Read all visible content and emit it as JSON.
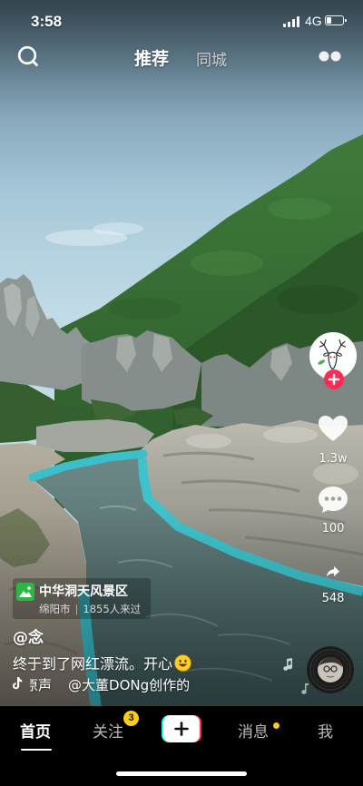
{
  "status_bar": {
    "time": "3:58",
    "network": "4G",
    "signal_icon": "signal-bars-icon",
    "battery_icon": "battery-icon",
    "battery_level": 0.3
  },
  "top_bar": {
    "left_icon": "search-icon",
    "right_icon": "more-dots-icon",
    "tabs": [
      {
        "label": "推荐",
        "active": true
      },
      {
        "label": "同城",
        "active": false
      }
    ]
  },
  "video": {
    "location": {
      "icon": "landscape-icon",
      "name": "中华洞天风景区",
      "city": "绵阳市",
      "separator": "|",
      "visitors": "1855人来过"
    },
    "author": "@念",
    "caption": "终于到了网红漂流。开心",
    "caption_emoji": "grinning-face-emoji-icon",
    "music": {
      "icon": "music-note-icon",
      "title": "原声",
      "creator": "@大董DONg创作的"
    }
  },
  "actions": {
    "author_avatar": "deer-avatar-icon",
    "follow_icon": "follow-plus-icon",
    "like": {
      "icon": "heart-icon",
      "count": "1.3w"
    },
    "comment": {
      "icon": "comment-icon",
      "count": "100"
    },
    "share": {
      "icon": "share-icon",
      "count": "548"
    },
    "music_disc": "music-disc-icon"
  },
  "bottom_nav": {
    "items": [
      {
        "label": "首页",
        "active": true
      },
      {
        "label": "关注",
        "badge": "3"
      },
      {
        "icon": "create-plus-icon"
      },
      {
        "label": "消息",
        "dot": true
      },
      {
        "label": "我"
      }
    ]
  },
  "colors": {
    "accent_red": "#fe2c55",
    "accent_cyan": "#25f4ee",
    "badge_yellow": "#face15",
    "location_green": "#2db742"
  }
}
